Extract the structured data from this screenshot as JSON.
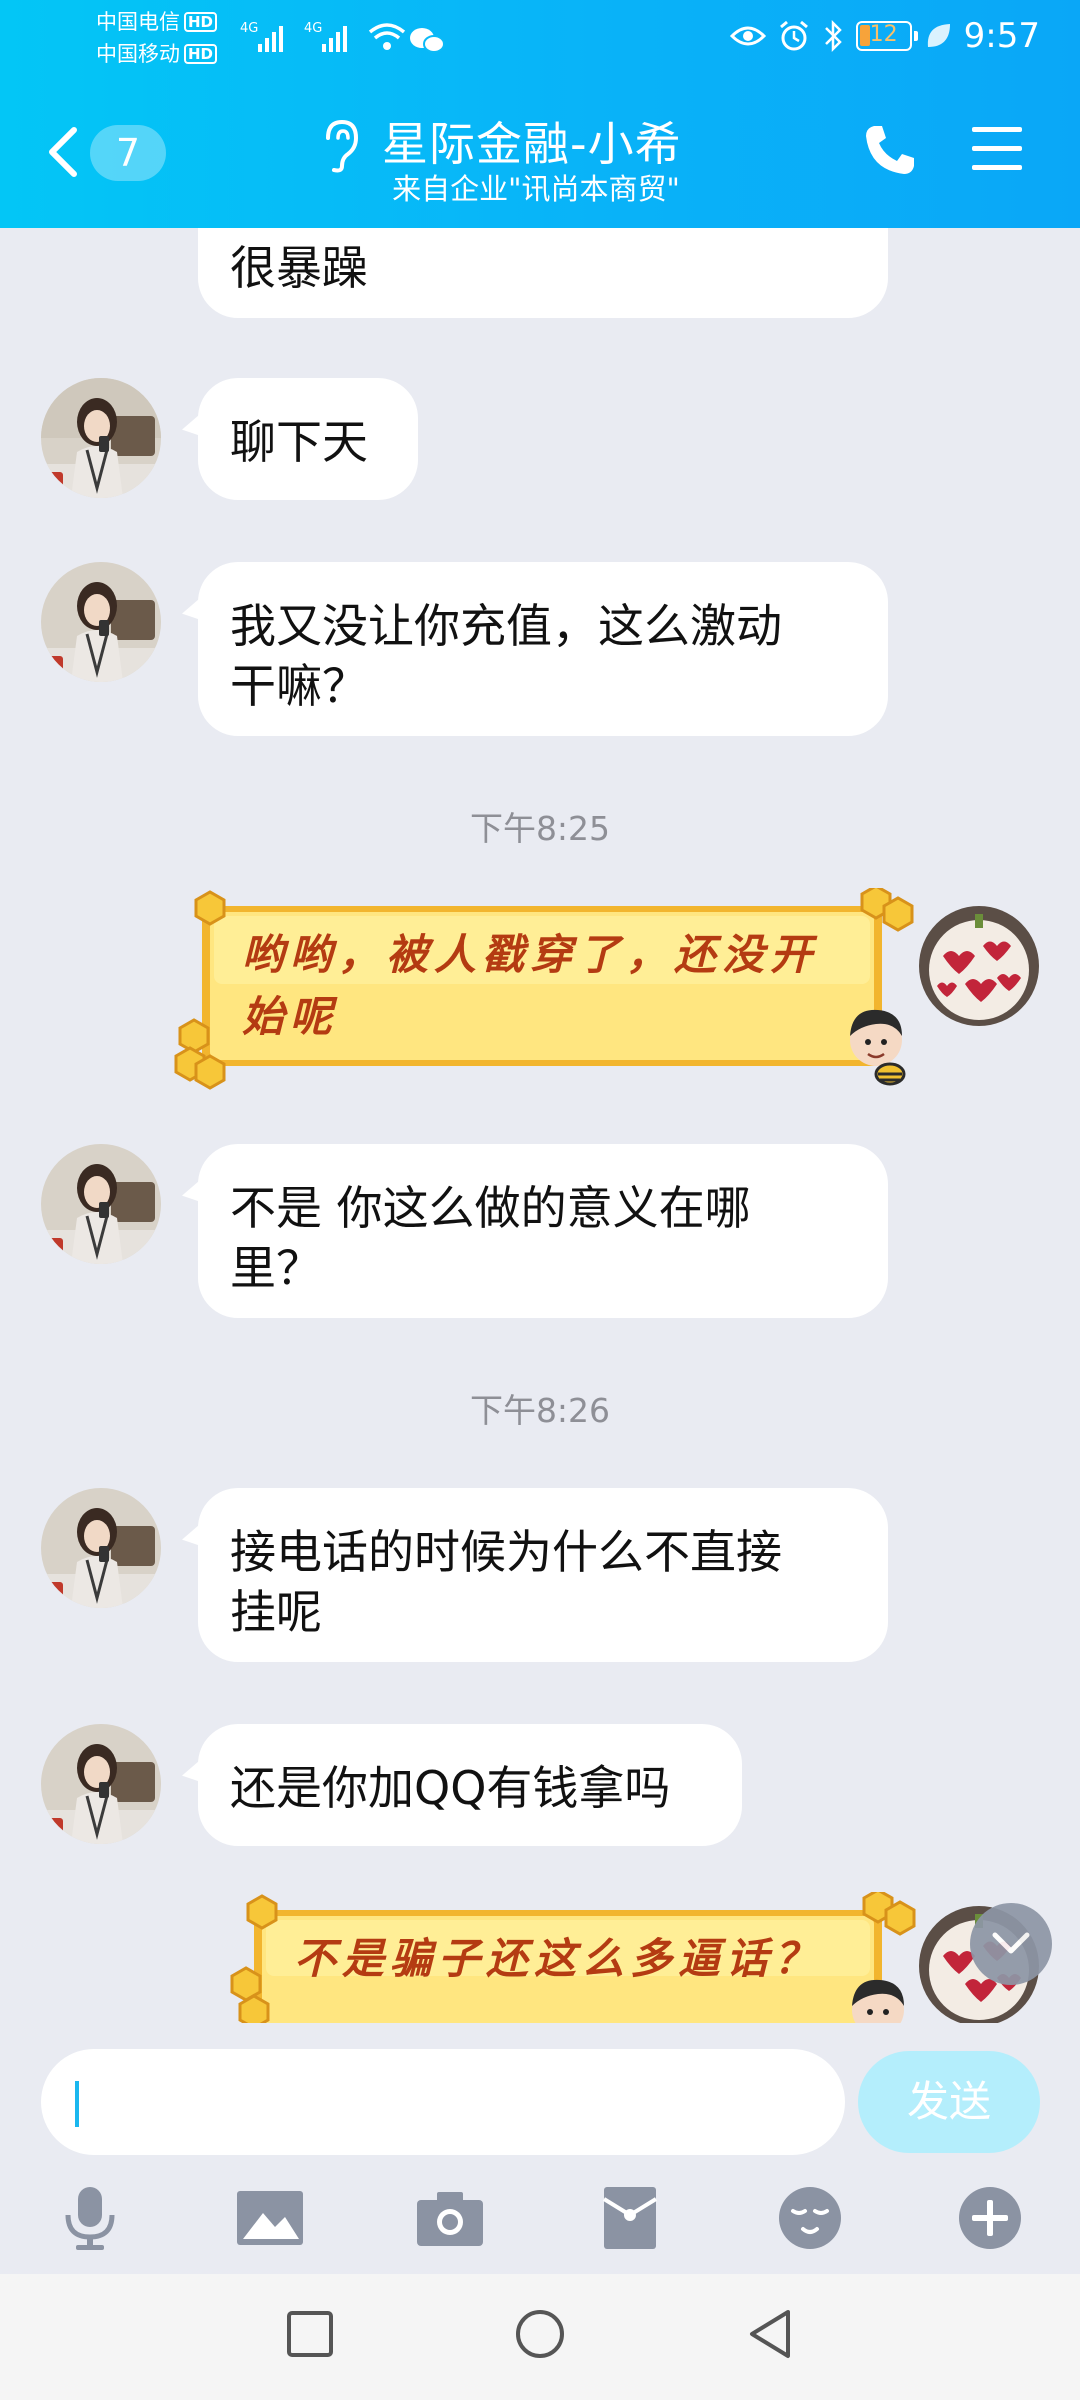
{
  "status_bar": {
    "carrier1": "中国电信",
    "carrier2": "中国移动",
    "hd": "HD",
    "net1": "4G",
    "net2": "4G",
    "battery": "12",
    "time": "9:57"
  },
  "header": {
    "unread_count": "7",
    "title": "星际金融-小希",
    "subtitle": "来自企业\"讯尚本商贸\""
  },
  "messages": [
    {
      "type": "text",
      "side": "left",
      "text": "很暴躁",
      "avatar": false
    },
    {
      "type": "text",
      "side": "left",
      "text": "聊下天"
    },
    {
      "type": "text",
      "side": "left",
      "line1": "我又没让你充值，这么激动",
      "line2": "干嘛？"
    },
    {
      "type": "time",
      "text": "下午8:25"
    },
    {
      "type": "sticker",
      "side": "right",
      "line1": "哟哟，被人戳穿了，还没开",
      "line2": "始呢"
    },
    {
      "type": "text",
      "side": "left",
      "line1": "不是 你这么做的意义在哪",
      "line2": "里？"
    },
    {
      "type": "time",
      "text": "下午8:26"
    },
    {
      "type": "text",
      "side": "left",
      "line1": "接电话的时候为什么不直接",
      "line2": "挂呢"
    },
    {
      "type": "text",
      "side": "left",
      "text": "还是你加QQ有钱拿吗"
    },
    {
      "type": "sticker",
      "side": "right",
      "text": "不是骗子还这么多逼话？"
    }
  ],
  "input": {
    "placeholder": "",
    "send_label": "发送"
  },
  "toolbar": [
    "mic-icon",
    "image-icon",
    "camera-icon",
    "red-packet-icon",
    "emoji-icon",
    "plus-icon"
  ],
  "colors": {
    "header_start": "#03c6f6",
    "header_end": "#0aa7f7",
    "chat_bg": "#e9ebf2",
    "sticker_text": "#b43b12",
    "send_bg": "#b4eefc"
  }
}
